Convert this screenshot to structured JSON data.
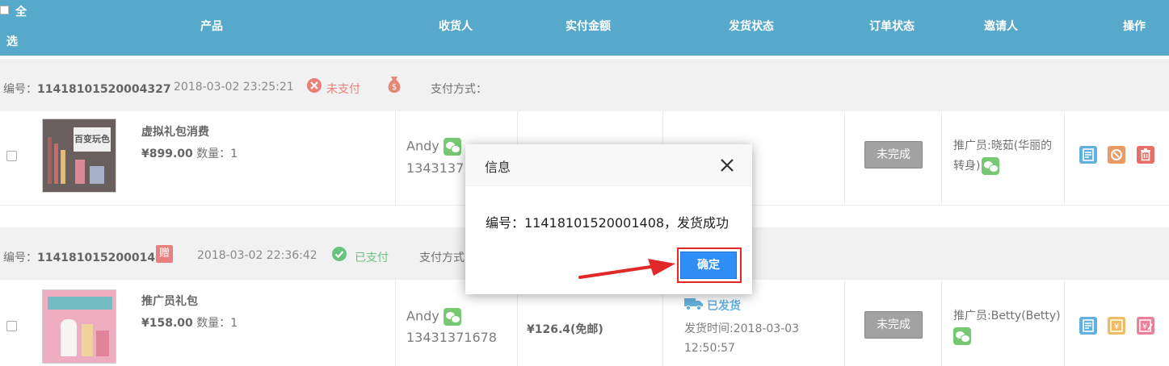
{
  "header": {
    "select_all_1": "全",
    "select_all_2": "选",
    "product": "产品",
    "receiver": "收货人",
    "amount": "实付金额",
    "ship_status": "发货状态",
    "order_status": "订单状态",
    "inviter": "邀请人",
    "actions": "操作"
  },
  "orders": [
    {
      "num_label": "编号：",
      "num": "11418101520004327",
      "date": "2018-03-02 23:25:21",
      "pay_status": "未支付",
      "pay_method": "支付方式：",
      "product_name": "虚拟礼包消费",
      "price": "¥899.00",
      "qty_label": " 数量：1",
      "receiver_name": "Andy",
      "receiver_phone": "13431371",
      "order_status": "未完成",
      "inviter_line1": "推广员:晓茹(华丽的",
      "inviter_line2": "转身)",
      "thumb_text": "百变玩色"
    },
    {
      "num_label": "编号：",
      "num": "11418101520001408",
      "gift": "赠",
      "date": "2018-03-02 22:36:42",
      "pay_status": "已支付",
      "pay_method": "支付方式",
      "product_name": "推广员礼包",
      "price": "¥158.00",
      "qty_label": " 数量：1",
      "receiver_name": "Andy",
      "receiver_phone": "13431371678",
      "amount": "¥126.4(免邮)",
      "ship_status": "已发货",
      "ship_time_1": "发货时间:2018-03-03",
      "ship_time_2": "12:50:57",
      "order_status": "未完成",
      "inviter_line1": "推广员:Betty(Betty)"
    }
  ],
  "dialog": {
    "title": "信息",
    "message": "编号：11418101520001408，发货成功",
    "ok": "确定"
  },
  "colors": {
    "header": "#0e85b4",
    "unpaid": "#e04a3c",
    "paid": "#2aa84a",
    "ok_button": "#2f8ef5",
    "highlight": "#e02828"
  }
}
